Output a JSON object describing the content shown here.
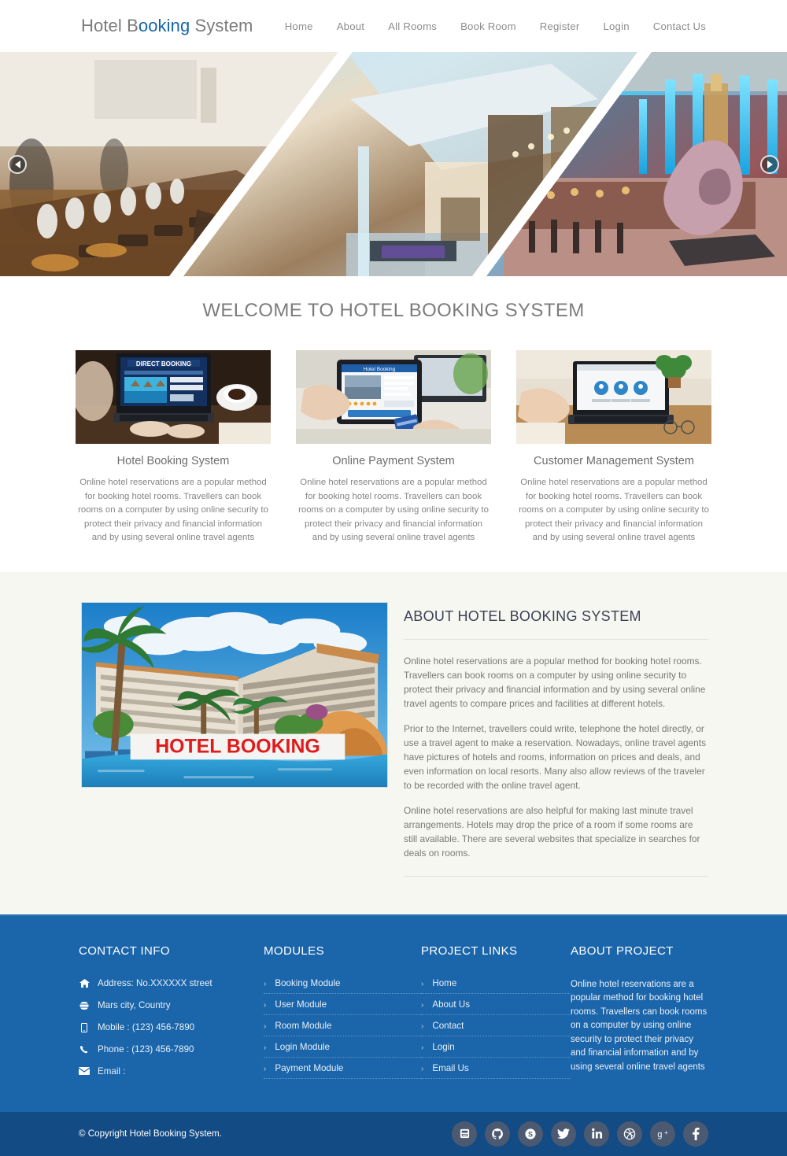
{
  "header": {
    "brand_part1": "Hotel B",
    "brand_part2": "ooking",
    "brand_part3": " System",
    "brand_full": "Hotel Booking System",
    "nav": [
      {
        "label": "Home"
      },
      {
        "label": "About"
      },
      {
        "label": "All Rooms"
      },
      {
        "label": "Book Room"
      },
      {
        "label": "Register"
      },
      {
        "label": "Login"
      },
      {
        "label": "Contact Us"
      }
    ]
  },
  "hero": {
    "prev_icon": "chevron-left-icon",
    "next_icon": "chevron-right-icon",
    "slides": [
      {
        "alt": "hotel restaurant bar with wine glasses"
      },
      {
        "alt": "modern hotel lobby interior"
      },
      {
        "alt": "hotel atrium with sculpture and bar"
      }
    ]
  },
  "welcome": {
    "title": "WELCOME TO HOTEL BOOKING SYSTEM",
    "features": [
      {
        "title": "Hotel Booking System",
        "text": "Online hotel reservations are a popular method for booking hotel rooms. Travellers can book rooms on a computer by using online security to protect their privacy and financial information and by using several online travel agents",
        "image_alt": "laptop showing DIRECT BOOKING website with coffee cup"
      },
      {
        "title": "Online Payment System",
        "text": "Online hotel reservations are a popular method for booking hotel rooms. Travellers can book rooms on a computer by using online security to protect their privacy and financial information and by using several online travel agents",
        "image_alt": "hands holding tablet with hotel booking app and credit card"
      },
      {
        "title": "Customer Management System",
        "text": "Online hotel reservations are a popular method for booking hotel rooms. Travellers can book rooms on a computer by using online security to protect their privacy and financial information and by using several online travel agents",
        "image_alt": "person typing on laptop at desk with plant and glasses"
      }
    ]
  },
  "about": {
    "title": "ABOUT HOTEL BOOKING SYSTEM",
    "image_alt": "resort hotel with pool and palm trees",
    "image_caption": "HOTEL BOOKING",
    "paragraphs": [
      "Online hotel reservations are a popular method for booking hotel rooms. Travellers can book rooms on a computer by using online security to protect their privacy and financial information and by using several online travel agents to compare prices and facilities at different hotels.",
      "Prior to the Internet, travellers could write, telephone the hotel directly, or use a travel agent to make a reservation. Nowadays, online travel agents have pictures of hotels and rooms, information on prices and deals, and even information on local resorts. Many also allow reviews of the traveler to be recorded with the online travel agent.",
      "Online hotel reservations are also helpful for making last minute travel arrangements. Hotels may drop the price of a room if some rooms are still available. There are several websites that specialize in searches for deals on rooms."
    ]
  },
  "footer": {
    "contact": {
      "heading": "CONTACT INFO",
      "rows": [
        {
          "icon": "home-icon",
          "text": "Address: No.XXXXXX street"
        },
        {
          "icon": "globe-icon",
          "text": "Mars city, Country"
        },
        {
          "icon": "mobile-icon",
          "text": "Mobile : (123) 456-7890"
        },
        {
          "icon": "phone-icon",
          "text": "Phone : (123) 456-7890"
        },
        {
          "icon": "envelope-icon",
          "text": "Email :"
        }
      ]
    },
    "modules": {
      "heading": "MODULES",
      "items": [
        {
          "label": "Booking Module"
        },
        {
          "label": "User Module"
        },
        {
          "label": "Room Module"
        },
        {
          "label": "Login Module"
        },
        {
          "label": "Payment Module"
        }
      ]
    },
    "links": {
      "heading": "PROJECT LINKS",
      "items": [
        {
          "label": "Home"
        },
        {
          "label": "About Us"
        },
        {
          "label": "Contact"
        },
        {
          "label": "Login"
        },
        {
          "label": "Email Us"
        }
      ]
    },
    "about_project": {
      "heading": "ABOUT PROJECT",
      "text": "Online hotel reservations are a popular method for booking hotel rooms. Travellers can book rooms on a computer by using online security to protect their privacy and financial information and by using several online travel agents"
    }
  },
  "copyright": {
    "text": "© Copyright Hotel Booking System.",
    "socials": [
      {
        "name": "youtube-icon"
      },
      {
        "name": "github-icon"
      },
      {
        "name": "skype-icon"
      },
      {
        "name": "twitter-icon"
      },
      {
        "name": "linkedin-icon"
      },
      {
        "name": "dribbble-icon"
      },
      {
        "name": "google-plus-icon"
      },
      {
        "name": "facebook-icon"
      }
    ]
  },
  "colors": {
    "brand_blue": "#1565a8",
    "footer_blue": "#1b65ab",
    "copybar_blue": "#134b84",
    "about_bg": "#f6f7f1",
    "social_grey": "#4b5a70",
    "caption_red": "#e01b1b"
  }
}
